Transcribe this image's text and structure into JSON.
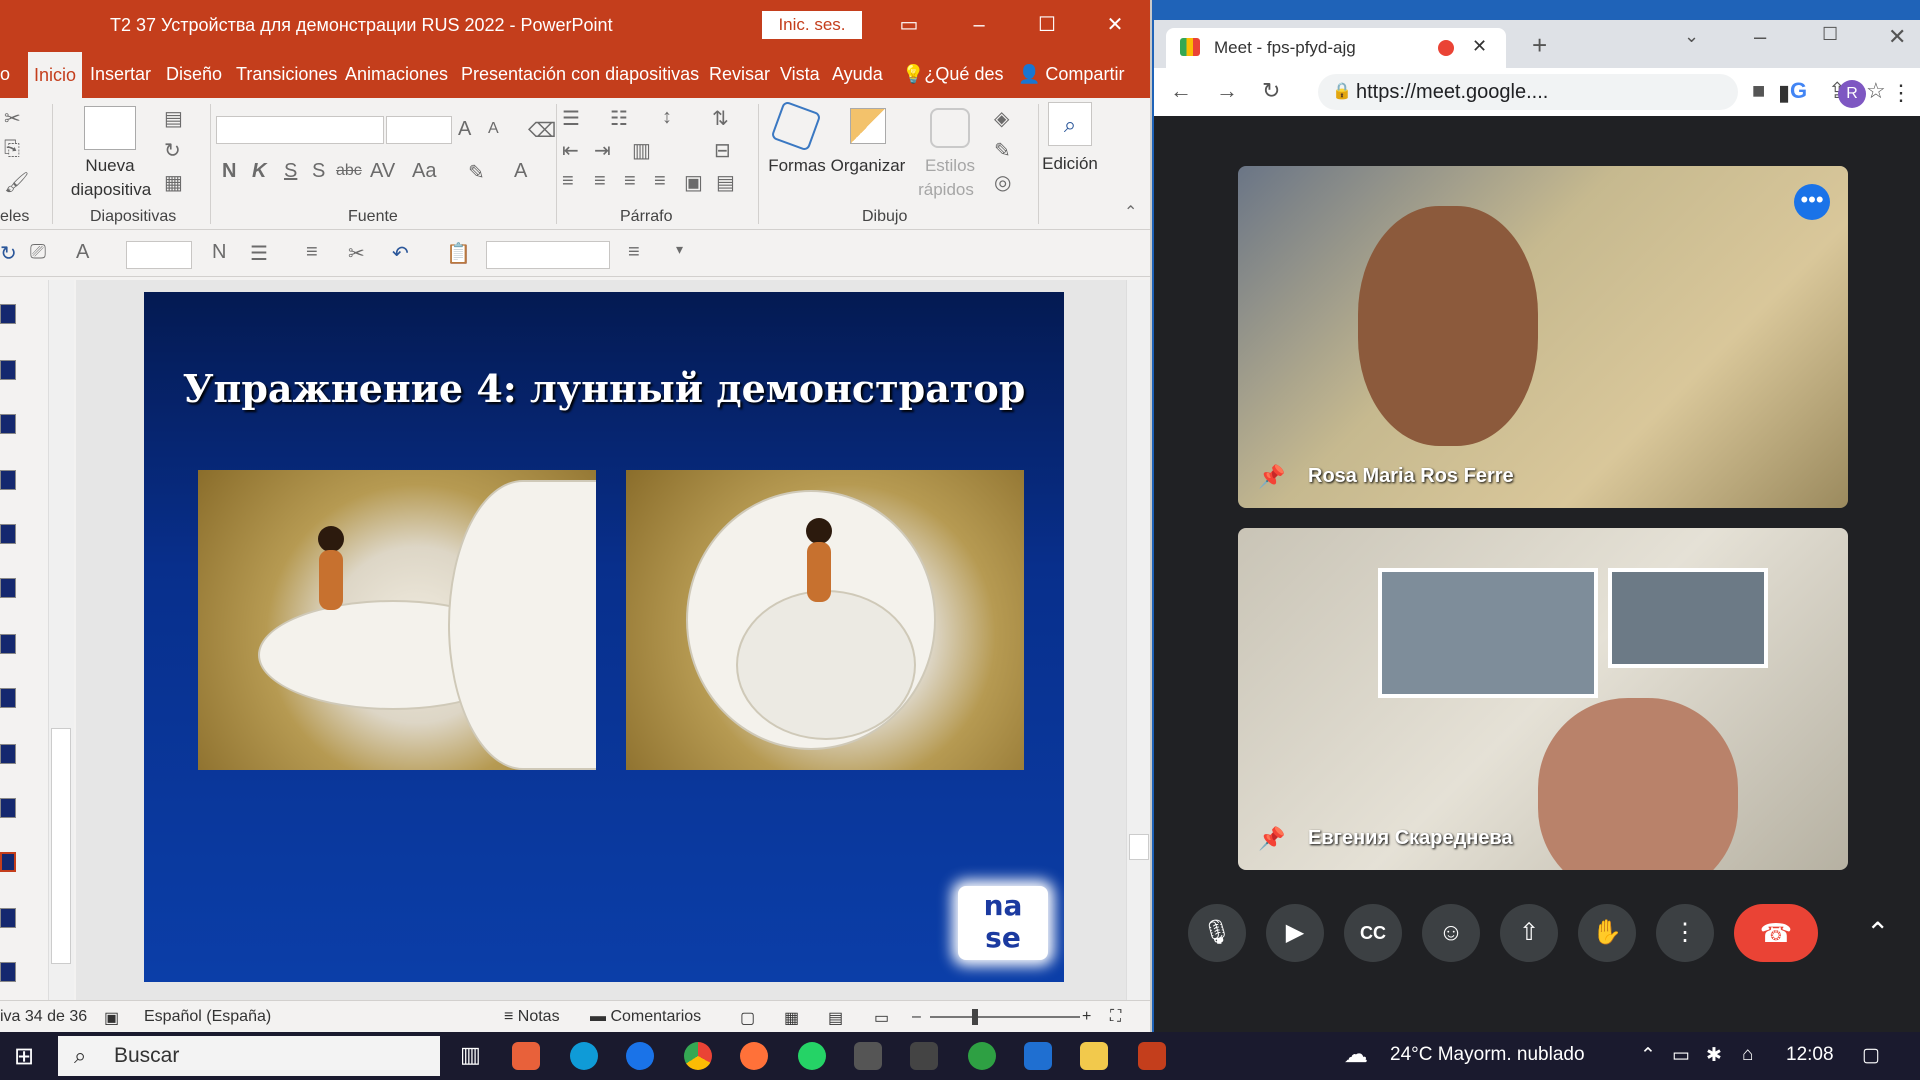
{
  "ppt": {
    "title": "T2 37 Устройства для демонстрации RUS 2022  -  PowerPoint",
    "signin": "Inic. ses.",
    "tabs": [
      "o",
      "Inicio",
      "Insertar",
      "Diseño",
      "Transiciones",
      "Animaciones",
      "Presentación con diapositivas",
      "Revisar",
      "Vista",
      "Ayuda",
      "¿Qué des",
      "Compartir"
    ],
    "ribbon": {
      "new_slide": "Nueva",
      "new_slide2": "diapositiva",
      "group_slides": "Diapositivas",
      "group_font": "Fuente",
      "group_paragraph": "Párrafo",
      "group_drawing": "Dibujo",
      "clipboard_label": "eles",
      "shapes": "Formas",
      "arrange": "Organizar",
      "quick_styles": "Estilos",
      "quick_styles2": "rápidos",
      "editing": "Edición",
      "font_btns": [
        "N",
        "K",
        "S",
        "S",
        "abc",
        "AV",
        "Aa",
        "A"
      ]
    },
    "slide": {
      "title": "Упражнение 4: лунный демонстратор",
      "logo_top": "na",
      "logo_bottom": "se"
    },
    "status": {
      "slide_count": "iva 34 de 36",
      "language": "Español (España)",
      "notes": "Notas",
      "comments": "Comentarios"
    }
  },
  "chrome": {
    "tab_title": "Meet - fps-pfyd-ajg",
    "url": "https://meet.google....",
    "avatar_letter": "R",
    "participants": [
      {
        "name": "Rosa Maria Ros Ferre"
      },
      {
        "name": "Евгения Скареднева"
      }
    ]
  },
  "taskbar": {
    "search": "Buscar",
    "weather": "24°C  Mayorm. nublado",
    "time": "12:08"
  },
  "colors": {
    "ppt_accent": "#c43e1c",
    "meet_bg": "#202124",
    "end_call": "#ea4335"
  }
}
